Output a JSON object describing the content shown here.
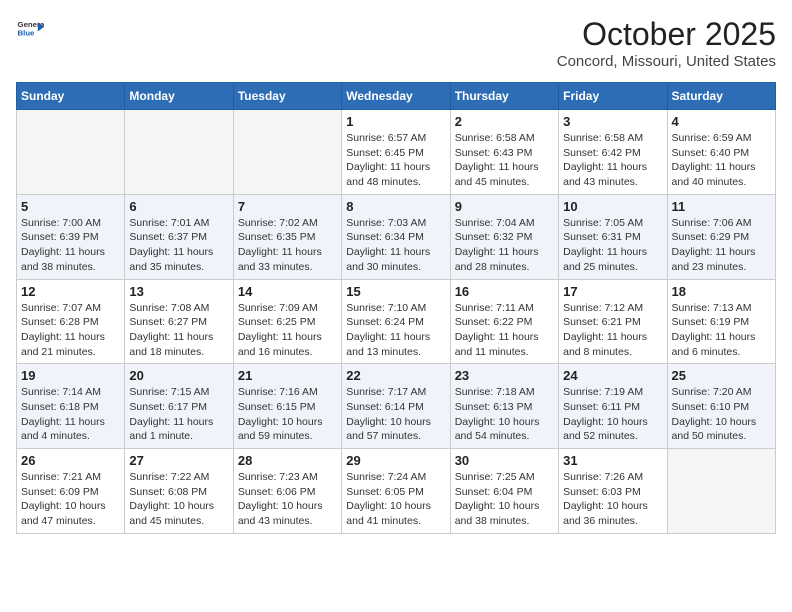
{
  "header": {
    "logo_general": "General",
    "logo_blue": "Blue",
    "month": "October 2025",
    "location": "Concord, Missouri, United States"
  },
  "days_of_week": [
    "Sunday",
    "Monday",
    "Tuesday",
    "Wednesday",
    "Thursday",
    "Friday",
    "Saturday"
  ],
  "weeks": [
    [
      {
        "day": "",
        "info": ""
      },
      {
        "day": "",
        "info": ""
      },
      {
        "day": "",
        "info": ""
      },
      {
        "day": "1",
        "info": "Sunrise: 6:57 AM\nSunset: 6:45 PM\nDaylight: 11 hours and 48 minutes."
      },
      {
        "day": "2",
        "info": "Sunrise: 6:58 AM\nSunset: 6:43 PM\nDaylight: 11 hours and 45 minutes."
      },
      {
        "day": "3",
        "info": "Sunrise: 6:58 AM\nSunset: 6:42 PM\nDaylight: 11 hours and 43 minutes."
      },
      {
        "day": "4",
        "info": "Sunrise: 6:59 AM\nSunset: 6:40 PM\nDaylight: 11 hours and 40 minutes."
      }
    ],
    [
      {
        "day": "5",
        "info": "Sunrise: 7:00 AM\nSunset: 6:39 PM\nDaylight: 11 hours and 38 minutes."
      },
      {
        "day": "6",
        "info": "Sunrise: 7:01 AM\nSunset: 6:37 PM\nDaylight: 11 hours and 35 minutes."
      },
      {
        "day": "7",
        "info": "Sunrise: 7:02 AM\nSunset: 6:35 PM\nDaylight: 11 hours and 33 minutes."
      },
      {
        "day": "8",
        "info": "Sunrise: 7:03 AM\nSunset: 6:34 PM\nDaylight: 11 hours and 30 minutes."
      },
      {
        "day": "9",
        "info": "Sunrise: 7:04 AM\nSunset: 6:32 PM\nDaylight: 11 hours and 28 minutes."
      },
      {
        "day": "10",
        "info": "Sunrise: 7:05 AM\nSunset: 6:31 PM\nDaylight: 11 hours and 25 minutes."
      },
      {
        "day": "11",
        "info": "Sunrise: 7:06 AM\nSunset: 6:29 PM\nDaylight: 11 hours and 23 minutes."
      }
    ],
    [
      {
        "day": "12",
        "info": "Sunrise: 7:07 AM\nSunset: 6:28 PM\nDaylight: 11 hours and 21 minutes."
      },
      {
        "day": "13",
        "info": "Sunrise: 7:08 AM\nSunset: 6:27 PM\nDaylight: 11 hours and 18 minutes."
      },
      {
        "day": "14",
        "info": "Sunrise: 7:09 AM\nSunset: 6:25 PM\nDaylight: 11 hours and 16 minutes."
      },
      {
        "day": "15",
        "info": "Sunrise: 7:10 AM\nSunset: 6:24 PM\nDaylight: 11 hours and 13 minutes."
      },
      {
        "day": "16",
        "info": "Sunrise: 7:11 AM\nSunset: 6:22 PM\nDaylight: 11 hours and 11 minutes."
      },
      {
        "day": "17",
        "info": "Sunrise: 7:12 AM\nSunset: 6:21 PM\nDaylight: 11 hours and 8 minutes."
      },
      {
        "day": "18",
        "info": "Sunrise: 7:13 AM\nSunset: 6:19 PM\nDaylight: 11 hours and 6 minutes."
      }
    ],
    [
      {
        "day": "19",
        "info": "Sunrise: 7:14 AM\nSunset: 6:18 PM\nDaylight: 11 hours and 4 minutes."
      },
      {
        "day": "20",
        "info": "Sunrise: 7:15 AM\nSunset: 6:17 PM\nDaylight: 11 hours and 1 minute."
      },
      {
        "day": "21",
        "info": "Sunrise: 7:16 AM\nSunset: 6:15 PM\nDaylight: 10 hours and 59 minutes."
      },
      {
        "day": "22",
        "info": "Sunrise: 7:17 AM\nSunset: 6:14 PM\nDaylight: 10 hours and 57 minutes."
      },
      {
        "day": "23",
        "info": "Sunrise: 7:18 AM\nSunset: 6:13 PM\nDaylight: 10 hours and 54 minutes."
      },
      {
        "day": "24",
        "info": "Sunrise: 7:19 AM\nSunset: 6:11 PM\nDaylight: 10 hours and 52 minutes."
      },
      {
        "day": "25",
        "info": "Sunrise: 7:20 AM\nSunset: 6:10 PM\nDaylight: 10 hours and 50 minutes."
      }
    ],
    [
      {
        "day": "26",
        "info": "Sunrise: 7:21 AM\nSunset: 6:09 PM\nDaylight: 10 hours and 47 minutes."
      },
      {
        "day": "27",
        "info": "Sunrise: 7:22 AM\nSunset: 6:08 PM\nDaylight: 10 hours and 45 minutes."
      },
      {
        "day": "28",
        "info": "Sunrise: 7:23 AM\nSunset: 6:06 PM\nDaylight: 10 hours and 43 minutes."
      },
      {
        "day": "29",
        "info": "Sunrise: 7:24 AM\nSunset: 6:05 PM\nDaylight: 10 hours and 41 minutes."
      },
      {
        "day": "30",
        "info": "Sunrise: 7:25 AM\nSunset: 6:04 PM\nDaylight: 10 hours and 38 minutes."
      },
      {
        "day": "31",
        "info": "Sunrise: 7:26 AM\nSunset: 6:03 PM\nDaylight: 10 hours and 36 minutes."
      },
      {
        "day": "",
        "info": ""
      }
    ]
  ]
}
